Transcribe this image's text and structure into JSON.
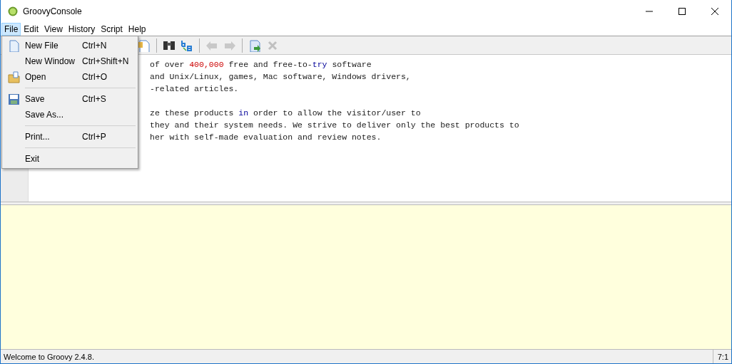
{
  "window": {
    "title": "GroovyConsole"
  },
  "menubar": [
    {
      "label": "File",
      "selected": true
    },
    {
      "label": "Edit",
      "selected": false
    },
    {
      "label": "View",
      "selected": false
    },
    {
      "label": "History",
      "selected": false
    },
    {
      "label": "Script",
      "selected": false
    },
    {
      "label": "Help",
      "selected": false
    }
  ],
  "file_menu": [
    {
      "kind": "document_item",
      "label": "New File",
      "shortcut": "Ctrl+N"
    },
    {
      "kind": "item",
      "label": "New Window",
      "shortcut": "Ctrl+Shift+N"
    },
    {
      "kind": "folder_item",
      "label": "Open",
      "shortcut": "Ctrl+O"
    },
    {
      "kind": "separator"
    },
    {
      "kind": "disk_item",
      "label": "Save",
      "shortcut": "Ctrl+S"
    },
    {
      "kind": "item",
      "label": "Save As..."
    },
    {
      "kind": "separator"
    },
    {
      "kind": "item",
      "label": "Print...",
      "shortcut": "Ctrl+P"
    },
    {
      "kind": "separator"
    },
    {
      "kind": "item",
      "label": "Exit"
    }
  ],
  "toolbar": [
    {
      "kind": "paste",
      "disabled": false
    },
    {
      "kind": "separator"
    },
    {
      "kind": "find",
      "disabled": false
    },
    {
      "kind": "replace",
      "disabled": false
    },
    {
      "kind": "separator"
    },
    {
      "kind": "previous",
      "disabled": true
    },
    {
      "kind": "next",
      "disabled": true
    },
    {
      "kind": "separator"
    },
    {
      "kind": "run",
      "disabled": false
    },
    {
      "kind": "interrupt",
      "disabled": true
    }
  ],
  "editor": {
    "lines": [
      {
        "kind": "code",
        "segments": [
          {
            "kind": "plain",
            "text": "of over "
          },
          {
            "kind": "number",
            "text": "400,000"
          },
          {
            "kind": "plain",
            "text": " free and free-to-"
          },
          {
            "kind": "keyword",
            "text": "try"
          },
          {
            "kind": "plain",
            "text": " software"
          }
        ]
      },
      {
        "kind": "code",
        "segments": [
          {
            "kind": "plain",
            "text": "and Unix/Linux, games, Mac software, Windows drivers,"
          }
        ]
      },
      {
        "kind": "code",
        "segments": [
          {
            "kind": "plain",
            "text": "-related articles."
          }
        ]
      },
      {
        "kind": "blank"
      },
      {
        "kind": "code",
        "segments": [
          {
            "kind": "plain",
            "text": "ze these products "
          },
          {
            "kind": "keyword",
            "text": "in"
          },
          {
            "kind": "plain",
            "text": " order to allow the visitor/user to"
          }
        ]
      },
      {
        "kind": "code",
        "segments": [
          {
            "kind": "plain",
            "text": "they and their system needs. We strive to deliver only the best products to"
          }
        ]
      },
      {
        "kind": "code",
        "segments": [
          {
            "kind": "plain",
            "text": "her with self-made evaluation and review notes."
          }
        ]
      }
    ]
  },
  "status_bar": {
    "message": "Welcome to Groovy 2.4.8.",
    "position": "7:1"
  }
}
